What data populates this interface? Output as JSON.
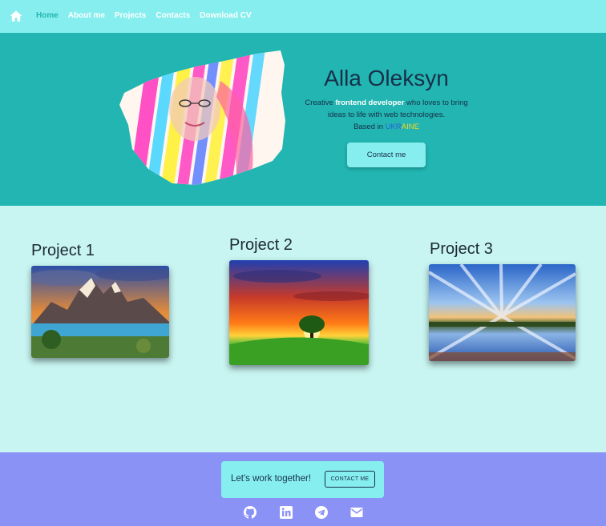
{
  "nav": {
    "home_icon": "home-icon",
    "links": [
      {
        "label": "Home",
        "active": true
      },
      {
        "label": "About me",
        "active": false
      },
      {
        "label": "Projects",
        "active": false
      },
      {
        "label": "Contacts",
        "active": false
      },
      {
        "label": "Download CV",
        "active": false
      }
    ]
  },
  "hero": {
    "name": "Alla Oleksyn",
    "line1_pre": "Creative ",
    "line1_highlight": "frontend developer",
    "line1_post": " who loves to bring",
    "line2": "ideas to life with web technologies.",
    "line3_pre": "Based in ",
    "line3_blue": "UKR",
    "line3_yellow": "AINE",
    "contact_button": "Contact me"
  },
  "projects": [
    {
      "title": "Project 1",
      "image": "mountain-lake"
    },
    {
      "title": "Project 2",
      "image": "sunset-tree"
    },
    {
      "title": "Project 3",
      "image": "sky-reflection"
    }
  ],
  "footer": {
    "cta_text": "Let's work together!",
    "cta_button": "CONTACT ME",
    "socials": [
      "github-icon",
      "linkedin-icon",
      "telegram-icon",
      "mail-icon"
    ]
  },
  "colors": {
    "nav_bg": "#86eeee",
    "hero_bg": "#22b5b1",
    "projects_bg": "#c8f4f1",
    "footer_bg": "#8b92f5",
    "active_link": "#22b6b3",
    "text_dark": "#17304a"
  }
}
